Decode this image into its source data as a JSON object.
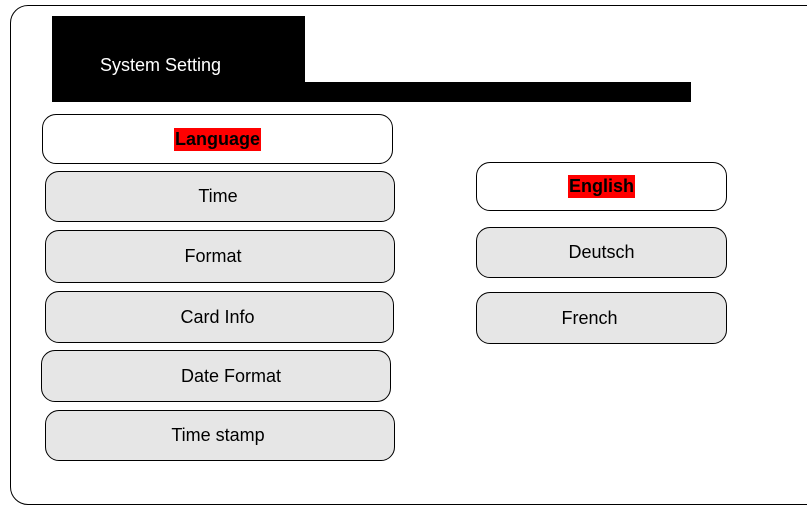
{
  "title": "System Setting",
  "menu": {
    "language": "Language",
    "time": "Time",
    "format": "Format",
    "card_info": "Card Info",
    "date_format": "Date Format",
    "time_stamp": "Time stamp"
  },
  "languages": {
    "english": "English",
    "deutsch": "Deutsch",
    "french": "French"
  },
  "colors": {
    "highlight": "#ff0000",
    "button_fill": "#e6e6e6",
    "header": "#000000"
  }
}
